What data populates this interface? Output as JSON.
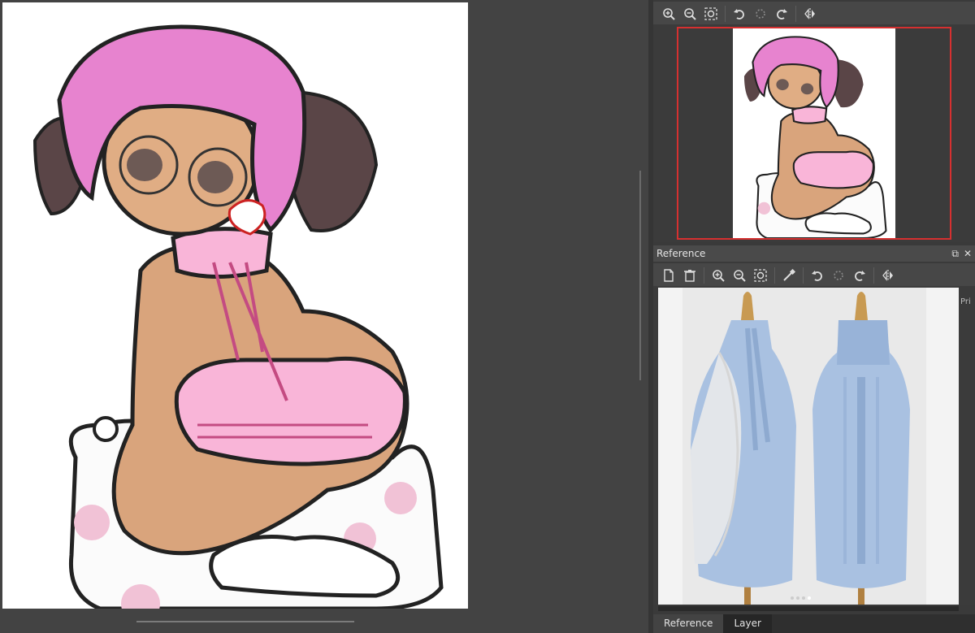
{
  "reference_panel": {
    "title": "Reference",
    "side_text": "Pri"
  },
  "tabs": [
    {
      "label": "Reference",
      "active": true
    },
    {
      "label": "Layer",
      "active": false
    }
  ],
  "icons": {
    "zoom_in": "zoom-in-icon",
    "zoom_out": "zoom-out-icon",
    "zoom_fit": "zoom-fit-icon",
    "rotate_left": "rotate-left-icon",
    "rotate_reset": "rotate-reset-icon",
    "rotate_right": "rotate-right-icon",
    "flip": "flip-horizontal-icon",
    "new": "new-file-icon",
    "delete": "trash-icon",
    "eyedropper": "eyedropper-icon"
  },
  "colors": {
    "navigator_frame": "#d63030",
    "hair_pink": "#e783cf",
    "sweater_pink": "#f9b5d8",
    "skin": "#d9a47c",
    "sweater_blue": "#a9c1e1"
  }
}
